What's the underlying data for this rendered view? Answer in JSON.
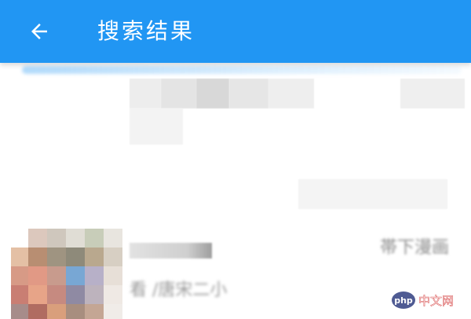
{
  "app_bar": {
    "title": "搜索结果",
    "back_icon": "arrow-left-icon",
    "color": "#2196f3"
  },
  "results": {
    "items": [
      {
        "badge": "帯下漫画",
        "subtitle": "看 /唐宋二小"
      }
    ]
  },
  "watermark": {
    "text": "php 中文网"
  }
}
